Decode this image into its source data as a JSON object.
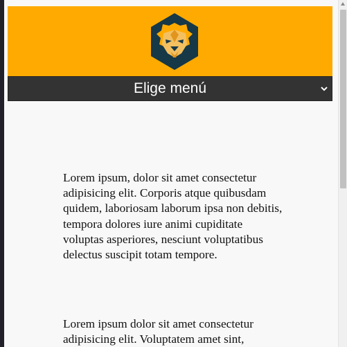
{
  "header": {
    "logo_icon": "lion-head-icon",
    "background_color": "#ffaa00",
    "logo_colors": {
      "hexagon": "#163847",
      "mane": "#ffaa00",
      "face": "#f3c061",
      "shadow": "#e2951e"
    }
  },
  "menu": {
    "selected_label": "Elige menú",
    "chevron_icon": "chevron-down-icon",
    "background_color": "#333333"
  },
  "content": {
    "paragraphs": [
      "Lorem ipsum, dolor sit amet consectetur adipisicing elit. Corporis atque quibusdam quidem, laboriosam laborum ipsa non debitis, tempora dolores iure animi cupiditate voluptas asperiores, nesciunt voluptatibus delectus suscipit totam tempore.",
      "Lorem ipsum dolor sit amet consectetur adipisicing elit. Voluptatem amet sint,"
    ]
  },
  "scrollbar": {
    "up_icon": "scroll-up-arrow-icon"
  }
}
